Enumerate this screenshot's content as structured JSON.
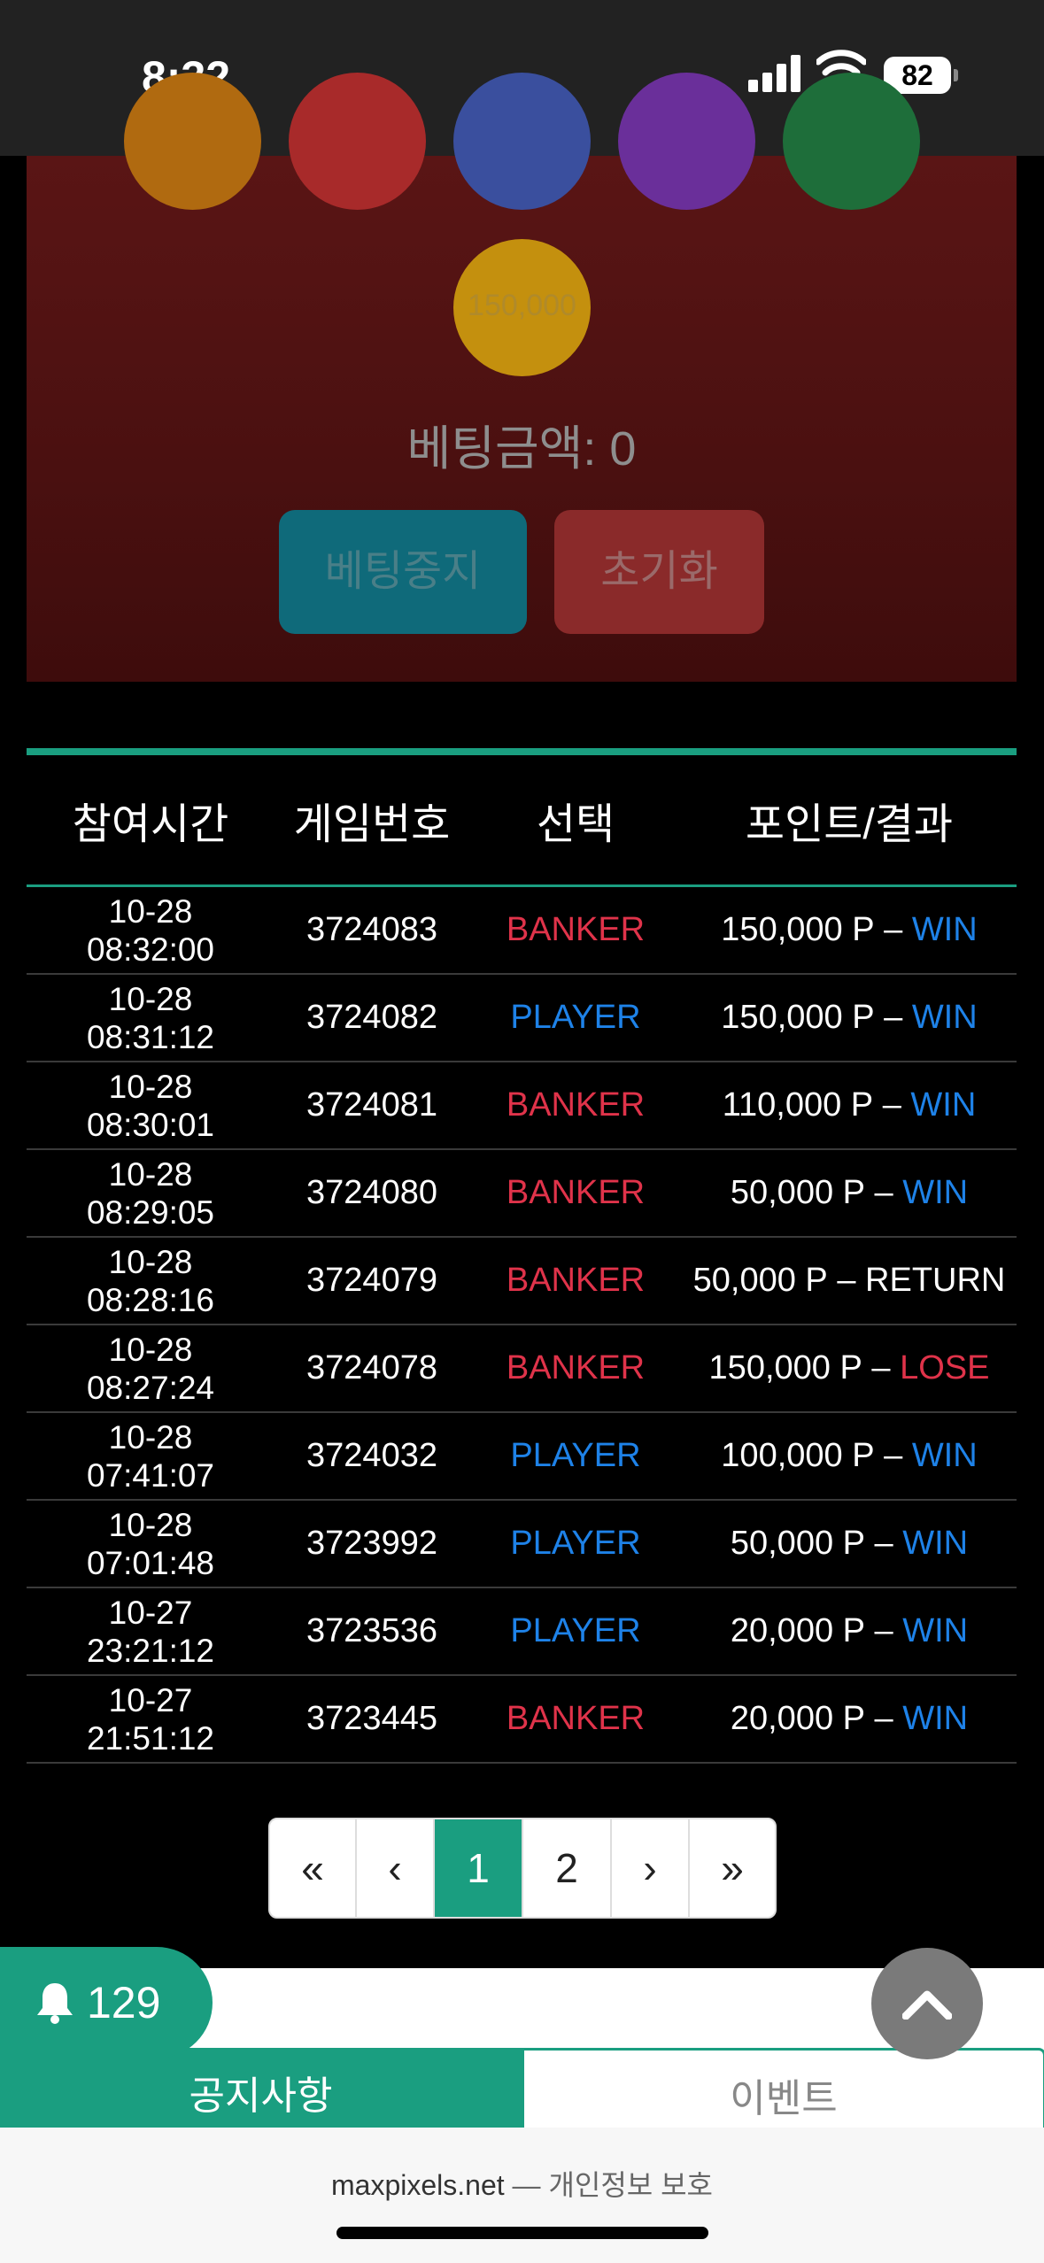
{
  "status_bar": {
    "time": "8:32",
    "battery": "82"
  },
  "bet_panel": {
    "chip_colors": [
      "#b06a10",
      "#a82a2a",
      "#3a4f9e",
      "#6a2f9a",
      "#1e6e3a"
    ],
    "selected_chip": {
      "label": "150,000",
      "color": "#c4900e"
    },
    "bet_amount_label": "베팅금액: 0",
    "stop_button": "베팅중지",
    "reset_button": "초기화"
  },
  "history": {
    "headers": [
      "참여시간",
      "게임번호",
      "선택",
      "포인트/결과"
    ],
    "rows": [
      {
        "date": "10-28",
        "time": "08:32:00",
        "game_no": "3724083",
        "choice": "BANKER",
        "points": "150,000 P",
        "result": "WIN"
      },
      {
        "date": "10-28",
        "time": "08:31:12",
        "game_no": "3724082",
        "choice": "PLAYER",
        "points": "150,000 P",
        "result": "WIN"
      },
      {
        "date": "10-28",
        "time": "08:30:01",
        "game_no": "3724081",
        "choice": "BANKER",
        "points": "110,000 P",
        "result": "WIN"
      },
      {
        "date": "10-28",
        "time": "08:29:05",
        "game_no": "3724080",
        "choice": "BANKER",
        "points": "50,000 P",
        "result": "WIN"
      },
      {
        "date": "10-28",
        "time": "08:28:16",
        "game_no": "3724079",
        "choice": "BANKER",
        "points": "50,000 P",
        "result": "RETURN"
      },
      {
        "date": "10-28",
        "time": "08:27:24",
        "game_no": "3724078",
        "choice": "BANKER",
        "points": "150,000 P",
        "result": "LOSE"
      },
      {
        "date": "10-28",
        "time": "07:41:07",
        "game_no": "3724032",
        "choice": "PLAYER",
        "points": "100,000 P",
        "result": "WIN"
      },
      {
        "date": "10-28",
        "time": "07:01:48",
        "game_no": "3723992",
        "choice": "PLAYER",
        "points": "50,000 P",
        "result": "WIN"
      },
      {
        "date": "10-27",
        "time": "23:21:12",
        "game_no": "3723536",
        "choice": "PLAYER",
        "points": "20,000 P",
        "result": "WIN"
      },
      {
        "date": "10-27",
        "time": "21:51:12",
        "game_no": "3723445",
        "choice": "BANKER",
        "points": "20,000 P",
        "result": "WIN"
      }
    ]
  },
  "pagination": {
    "first": "«",
    "prev": "‹",
    "pages": [
      "1",
      "2"
    ],
    "current": "1",
    "next": "›",
    "last": "»"
  },
  "notification": {
    "count": "129"
  },
  "tabs": {
    "notice": "공지사항",
    "event": "이벤트"
  },
  "browser": {
    "domain": "maxpixels.net",
    "separator": "—",
    "privacy": "개인정보 보호"
  }
}
